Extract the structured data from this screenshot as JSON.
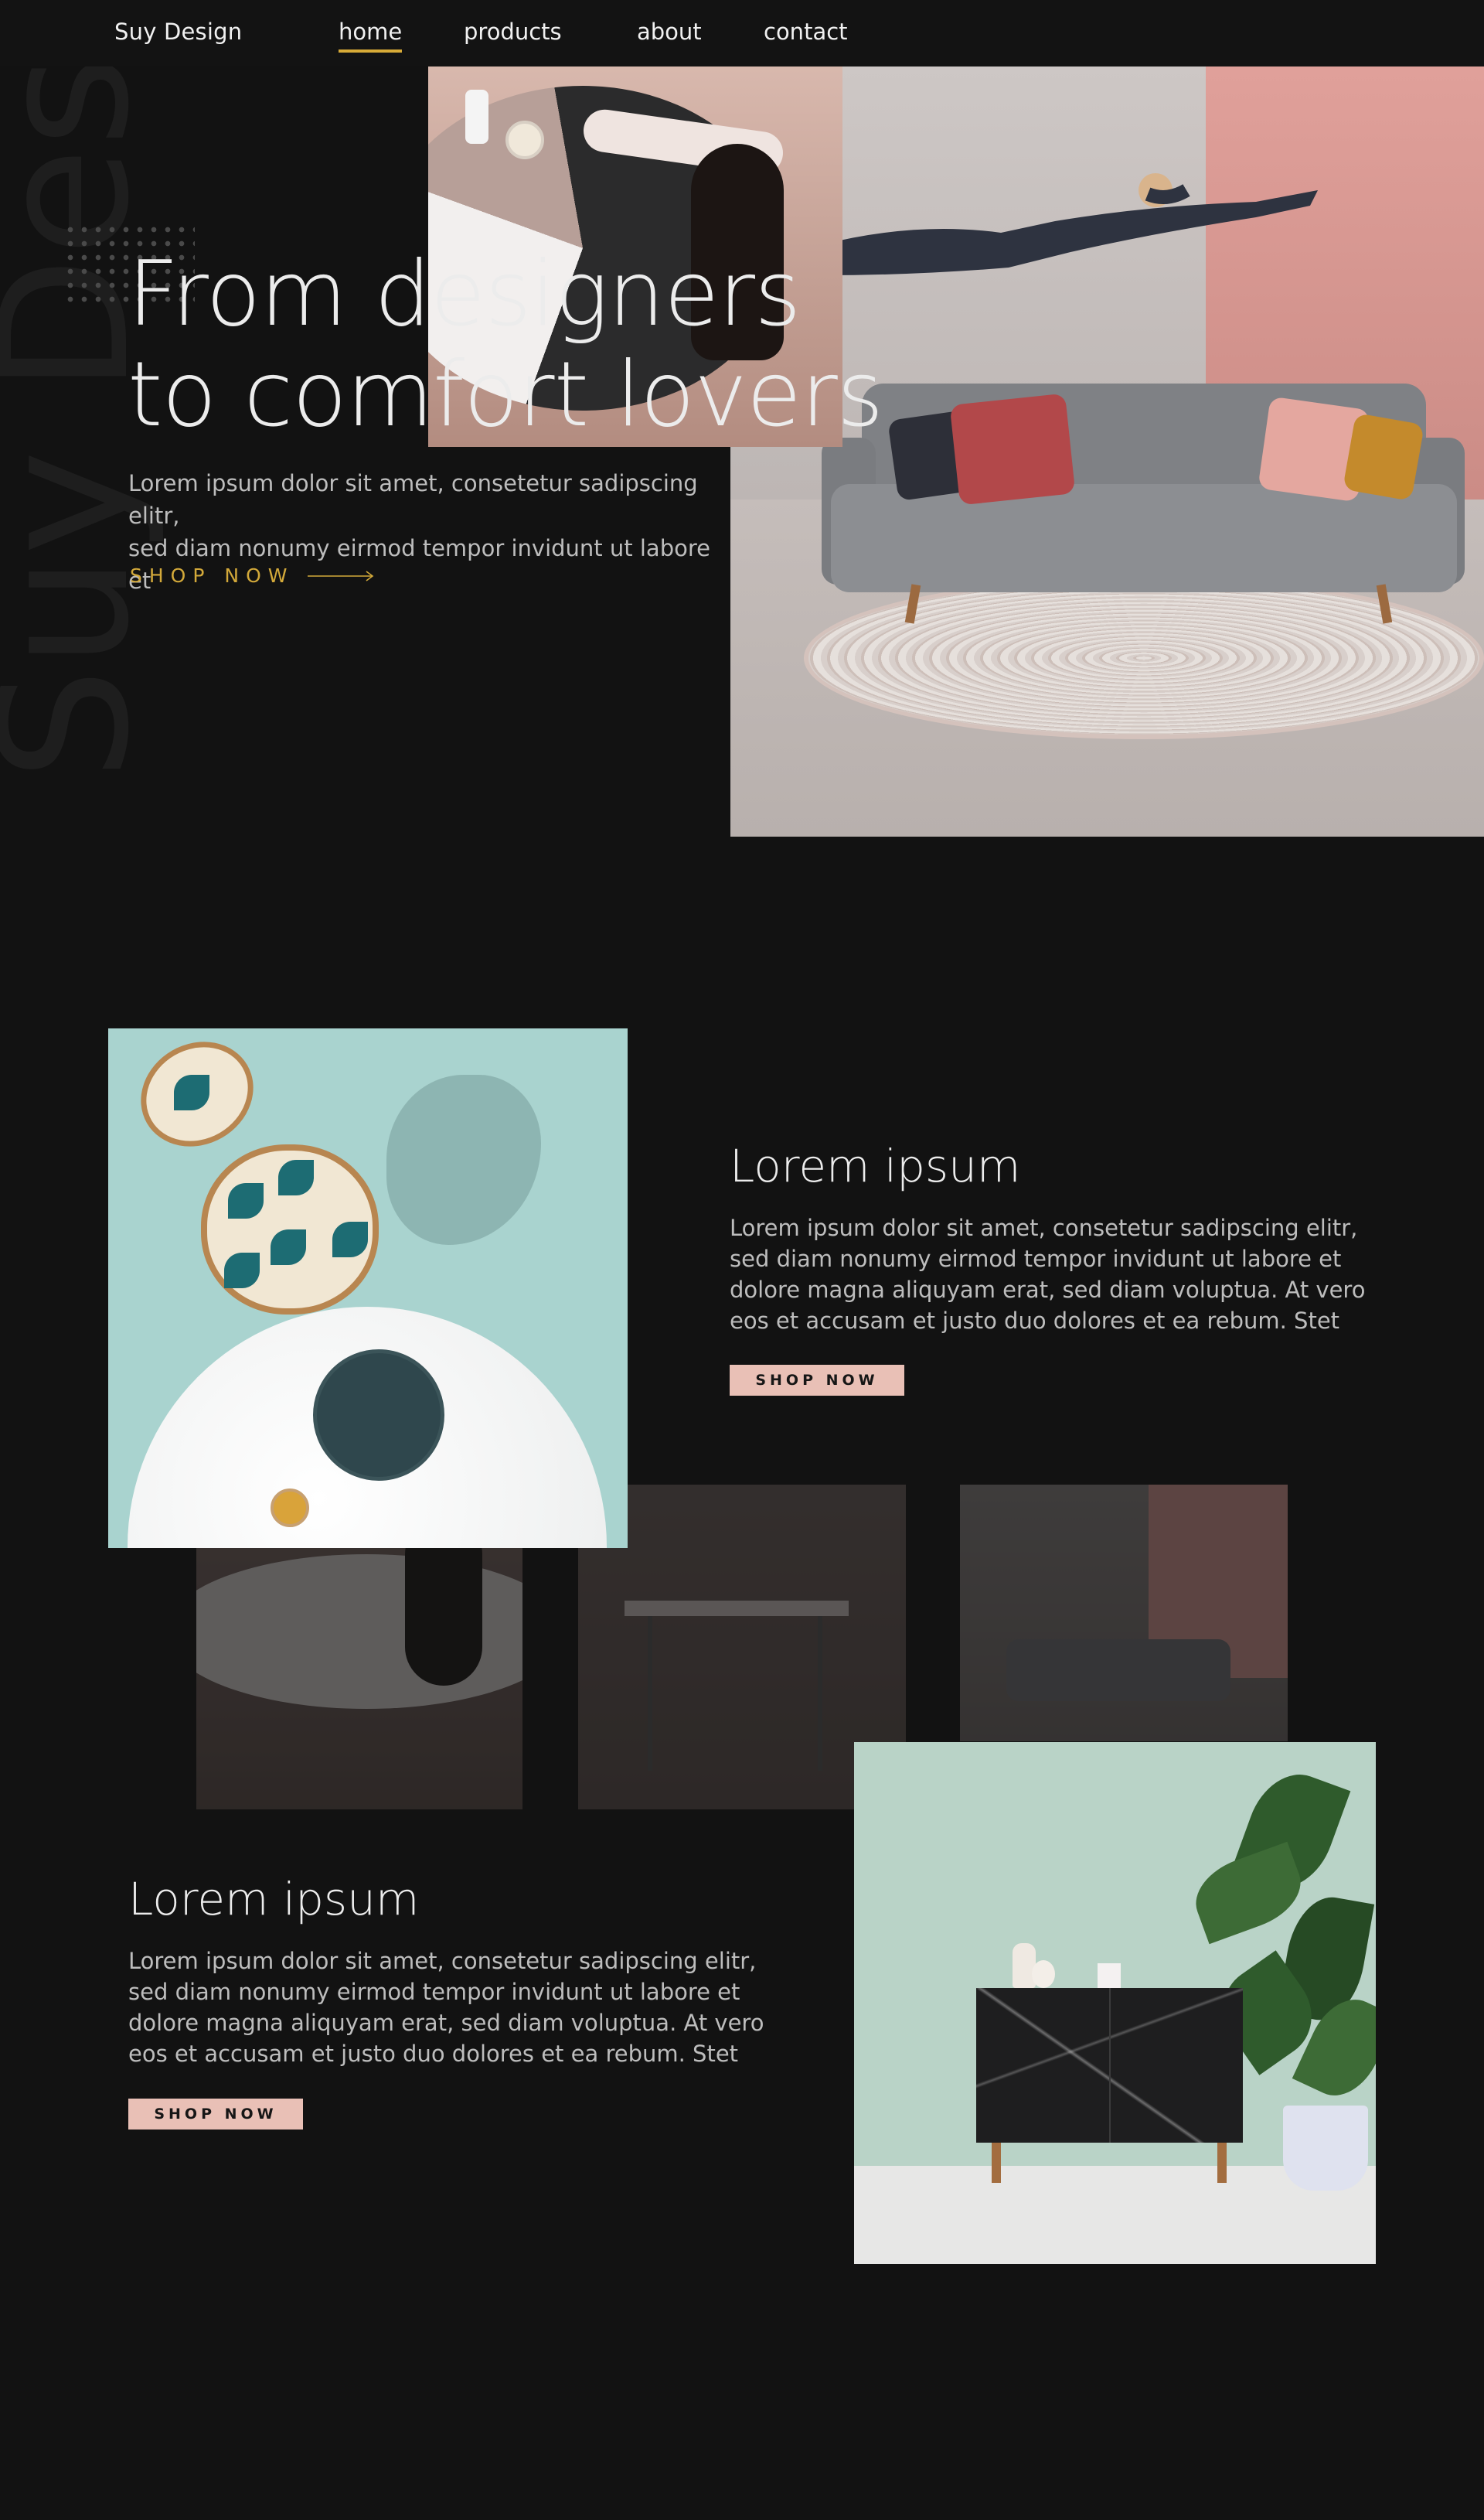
{
  "nav": {
    "brand": "Suy Design",
    "links": [
      {
        "label": "home",
        "active": true
      },
      {
        "label": "products",
        "active": false
      },
      {
        "label": "about",
        "active": false
      },
      {
        "label": "contact",
        "active": false
      }
    ]
  },
  "hero": {
    "watermark": "Suy Design",
    "title_line1": "From designers",
    "title_line2": "to comfort lovers",
    "subtitle_line1": "Lorem ipsum dolor sit amet, consetetur sadipscing elitr,",
    "subtitle_line2": "sed diam nonumy eirmod tempor invidunt ut labore et",
    "cta": "SHOP NOW"
  },
  "section2": {
    "title": "Lorem ipsum",
    "body": "Lorem ipsum dolor sit amet, consetetur sadipscing elitr, sed diam nonumy eirmod tempor invidunt ut labore et dolore magna aliquyam erat, sed diam voluptua. At vero eos et accusam et justo duo dolores et ea rebum. Stet",
    "button": "SHOP NOW"
  },
  "section3": {
    "title": "Lorem ipsum",
    "body": "Lorem ipsum dolor sit amet, consetetur sadipscing elitr, sed diam nonumy eirmod tempor invidunt ut labore et dolore magna aliquyam erat, sed diam voluptua. At vero eos et accusam et justo duo dolores et ea rebum. Stet",
    "button": "SHOP NOW"
  },
  "colors": {
    "background": "#121212",
    "accent_gold": "#d3a93a",
    "button_pink": "#e9c0b6",
    "text": "#ececec",
    "text_muted": "#bdbdbd"
  }
}
